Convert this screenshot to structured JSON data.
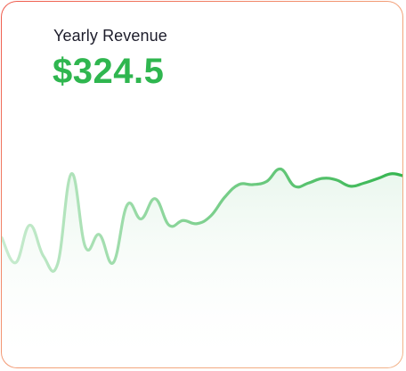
{
  "card": {
    "title": "Yearly Revenue",
    "value": "$324.5"
  },
  "colors": {
    "value": "#2fb64f",
    "line_start": "#c9ecd0",
    "line_end": "#34b54f",
    "area": "#e8f6ec",
    "border_start": "#ef5a4c",
    "border_end": "#f2b38a"
  },
  "chart_data": {
    "type": "area",
    "x": [
      0,
      1,
      2,
      3,
      4,
      5,
      6,
      7,
      8,
      9,
      10,
      11,
      12,
      13,
      14,
      15,
      16,
      17,
      18,
      19,
      20,
      21,
      22,
      23,
      24,
      25,
      26,
      27,
      28,
      29
    ],
    "values": [
      46,
      30,
      54,
      34,
      29,
      87,
      40,
      48,
      30,
      67,
      58,
      71,
      54,
      57,
      55,
      60,
      72,
      80,
      80,
      82,
      90,
      79,
      81,
      84,
      83,
      79,
      81,
      84,
      87,
      85
    ],
    "ylim": [
      0,
      100
    ],
    "grid": false,
    "xlabel": "",
    "ylabel": ""
  }
}
